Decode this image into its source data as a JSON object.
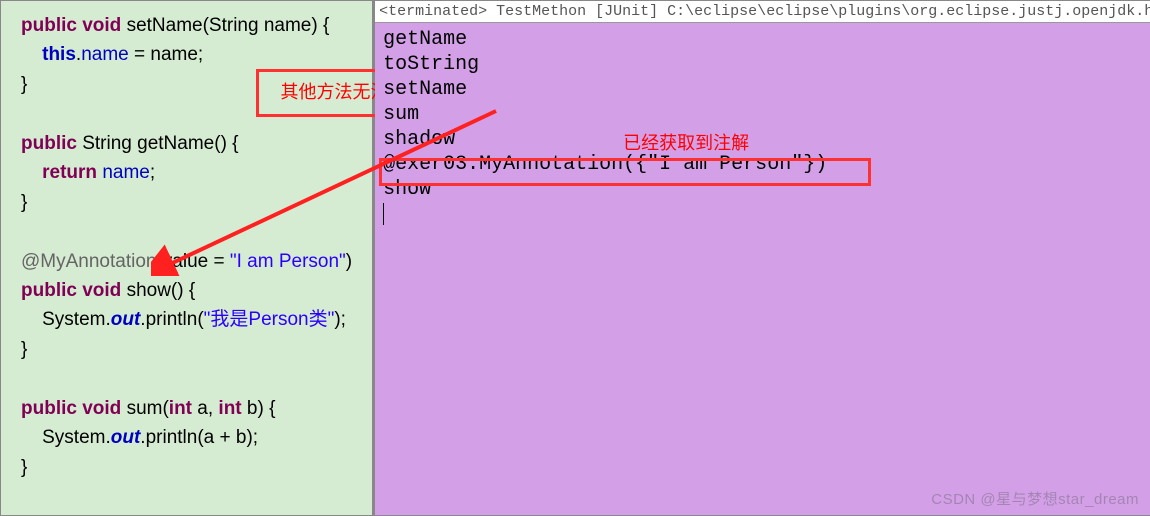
{
  "code": {
    "line1": {
      "kw1": "public",
      "kw2": "void",
      "method": " setName(String name) {"
    },
    "line2": {
      "kw_this": "this",
      "dot": ".",
      "field": "name",
      "rest": " = name;"
    },
    "line3": {
      "brace": "}"
    },
    "line5": {
      "kw1": "public",
      "type": " String getName() {"
    },
    "line6": {
      "kw_return": "return",
      "sp": " ",
      "field": "name",
      "semi": ";"
    },
    "line7": {
      "brace": "}"
    },
    "line9": {
      "ann": "@MyAnnotation",
      "open": "(value = ",
      "str": "\"I am Person\"",
      "close": ")"
    },
    "line10": {
      "kw1": "public",
      "kw2": "void",
      "method": " show() {"
    },
    "line11": {
      "sys": "System.",
      "out": "out",
      "rest1": ".println(",
      "str": "\"我是Person类\"",
      "rest2": ");"
    },
    "line12": {
      "brace": "}"
    },
    "line14": {
      "kw1": "public",
      "kw2": "void",
      "method": " sum(",
      "kw3": "int",
      "p1": " a, ",
      "kw4": "int",
      "p2": " b) {"
    },
    "line15": {
      "sys": "System.",
      "out": "out",
      "rest": ".println(a + b);"
    },
    "line16": {
      "brace": "}"
    }
  },
  "annotations": {
    "box1_label": "其他方法无注解",
    "box2_label": "已经获取到注解"
  },
  "terminal": {
    "header": "<terminated> TestMethon [JUnit] C:\\eclipse\\eclipse\\plugins\\org.eclipse.justj.openjdk.hotsp",
    "lines": [
      "getName",
      "toString",
      "setName",
      "sum",
      "shadow",
      "@exer03.MyAnnotation({\"I am Person\"})",
      "show"
    ]
  },
  "watermark": "CSDN @星与梦想star_dream"
}
